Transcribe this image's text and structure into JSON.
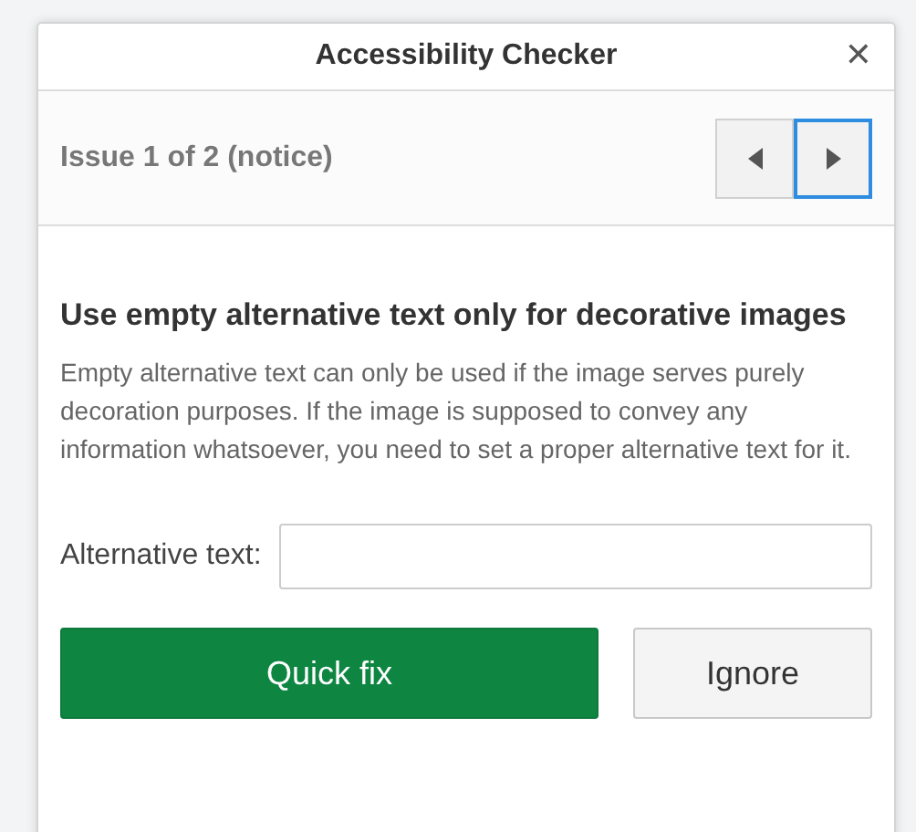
{
  "window": {
    "title": "Accessibility Checker",
    "close": "✕"
  },
  "issue": {
    "label": "Issue 1 of 2 (notice)"
  },
  "navigation": [
    {
      "kind": "previous",
      "focused": false
    },
    {
      "kind": "next",
      "focused": true
    }
  ],
  "heading": "Use empty alternative text only for decorative images",
  "description": "Empty alternative text can only be used if the image serves purely decoration purposes. If the image is supposed to convey any information whatsoever, you need to set a proper alternative text for it.",
  "field": {
    "label": "Alternative text:"
  },
  "buttons": [
    {
      "kind": "primary",
      "label": "Quick fix"
    },
    {
      "kind": "secondary",
      "label": "Ignore"
    }
  ]
}
